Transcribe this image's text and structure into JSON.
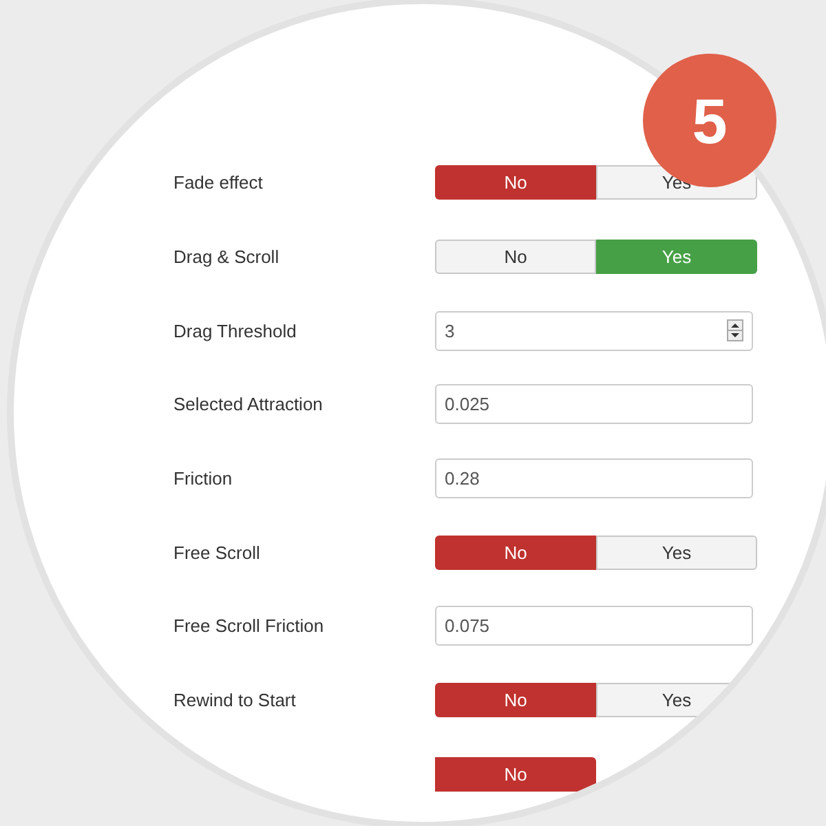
{
  "badge": {
    "text": "5"
  },
  "rows": [
    {
      "kind": "toggle",
      "label": "Fade effect",
      "options": [
        {
          "label": "No",
          "selected": true
        },
        {
          "label": "Yes",
          "selected": false
        }
      ]
    },
    {
      "kind": "toggle",
      "label": "Drag & Scroll",
      "options": [
        {
          "label": "No",
          "selected": false
        },
        {
          "label": "Yes",
          "selected": true
        }
      ]
    },
    {
      "kind": "number",
      "label": "Drag Threshold",
      "value": "3"
    },
    {
      "kind": "text",
      "label": "Selected Attraction",
      "value": "0.025"
    },
    {
      "kind": "text",
      "label": "Friction",
      "value": "0.28"
    },
    {
      "kind": "toggle",
      "label": "Free Scroll",
      "options": [
        {
          "label": "No",
          "selected": true
        },
        {
          "label": "Yes",
          "selected": false
        }
      ]
    },
    {
      "kind": "text",
      "label": "Free Scroll Friction",
      "value": "0.075"
    },
    {
      "kind": "toggle",
      "label": "Rewind to Start",
      "options": [
        {
          "label": "No",
          "selected": true
        },
        {
          "label": "Yes",
          "selected": false
        }
      ]
    },
    {
      "kind": "toggle",
      "options": [
        {
          "label": "No",
          "selected": true
        }
      ]
    }
  ]
}
